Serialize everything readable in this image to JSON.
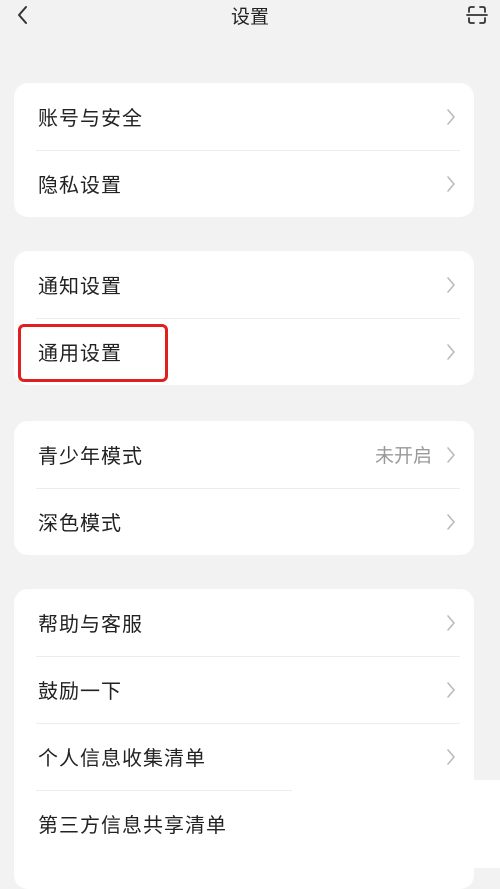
{
  "header": {
    "title": "设置",
    "back_icon": "back-chevron-icon",
    "scan_icon": "scan-icon"
  },
  "groups": [
    {
      "items": [
        {
          "label": "账号与安全"
        },
        {
          "label": "隐私设置"
        }
      ]
    },
    {
      "items": [
        {
          "label": "通知设置"
        },
        {
          "label": "通用设置"
        }
      ]
    },
    {
      "items": [
        {
          "label": "青少年模式",
          "value": "未开启"
        },
        {
          "label": "深色模式"
        }
      ]
    },
    {
      "items": [
        {
          "label": "帮助与客服"
        },
        {
          "label": "鼓励一下"
        },
        {
          "label": "个人信息收集清单"
        },
        {
          "label": "第三方信息共享清单"
        }
      ]
    }
  ],
  "colors": {
    "background": "#f2f2f2",
    "card": "#ffffff",
    "highlight": "#e02020",
    "secondary_text": "#999999"
  }
}
